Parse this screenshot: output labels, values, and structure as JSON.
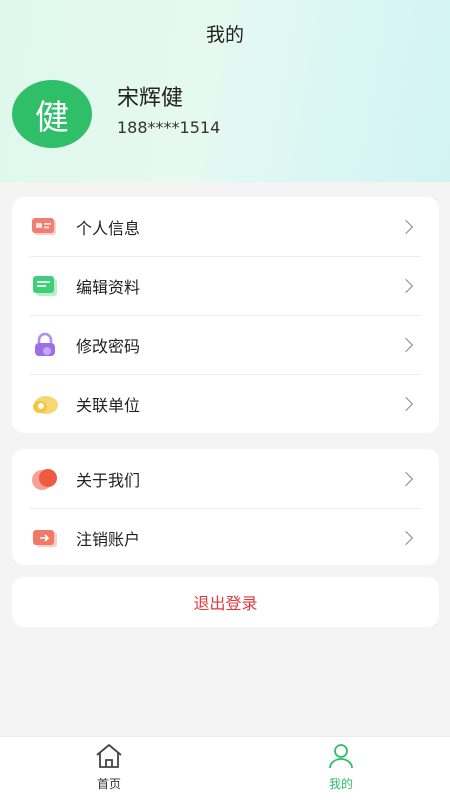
{
  "header": {
    "title": "我的",
    "avatar_char": "健",
    "user_name": "宋辉健",
    "phone": "188****1514"
  },
  "menu_group_1": [
    {
      "label": "个人信息",
      "icon": "id-card-icon"
    },
    {
      "label": "编辑资料",
      "icon": "edit-profile-icon"
    },
    {
      "label": "修改密码",
      "icon": "lock-icon"
    },
    {
      "label": "关联单位",
      "icon": "link-organization-icon"
    }
  ],
  "menu_group_2": [
    {
      "label": "关于我们",
      "icon": "about-icon"
    },
    {
      "label": "注销账户",
      "icon": "cancel-account-icon"
    }
  ],
  "logout": {
    "label": "退出登录"
  },
  "tabbar": {
    "home": {
      "label": "首页"
    },
    "mine": {
      "label": "我的"
    }
  },
  "colors": {
    "accent": "#2fbf69",
    "danger": "#e23b3b"
  }
}
